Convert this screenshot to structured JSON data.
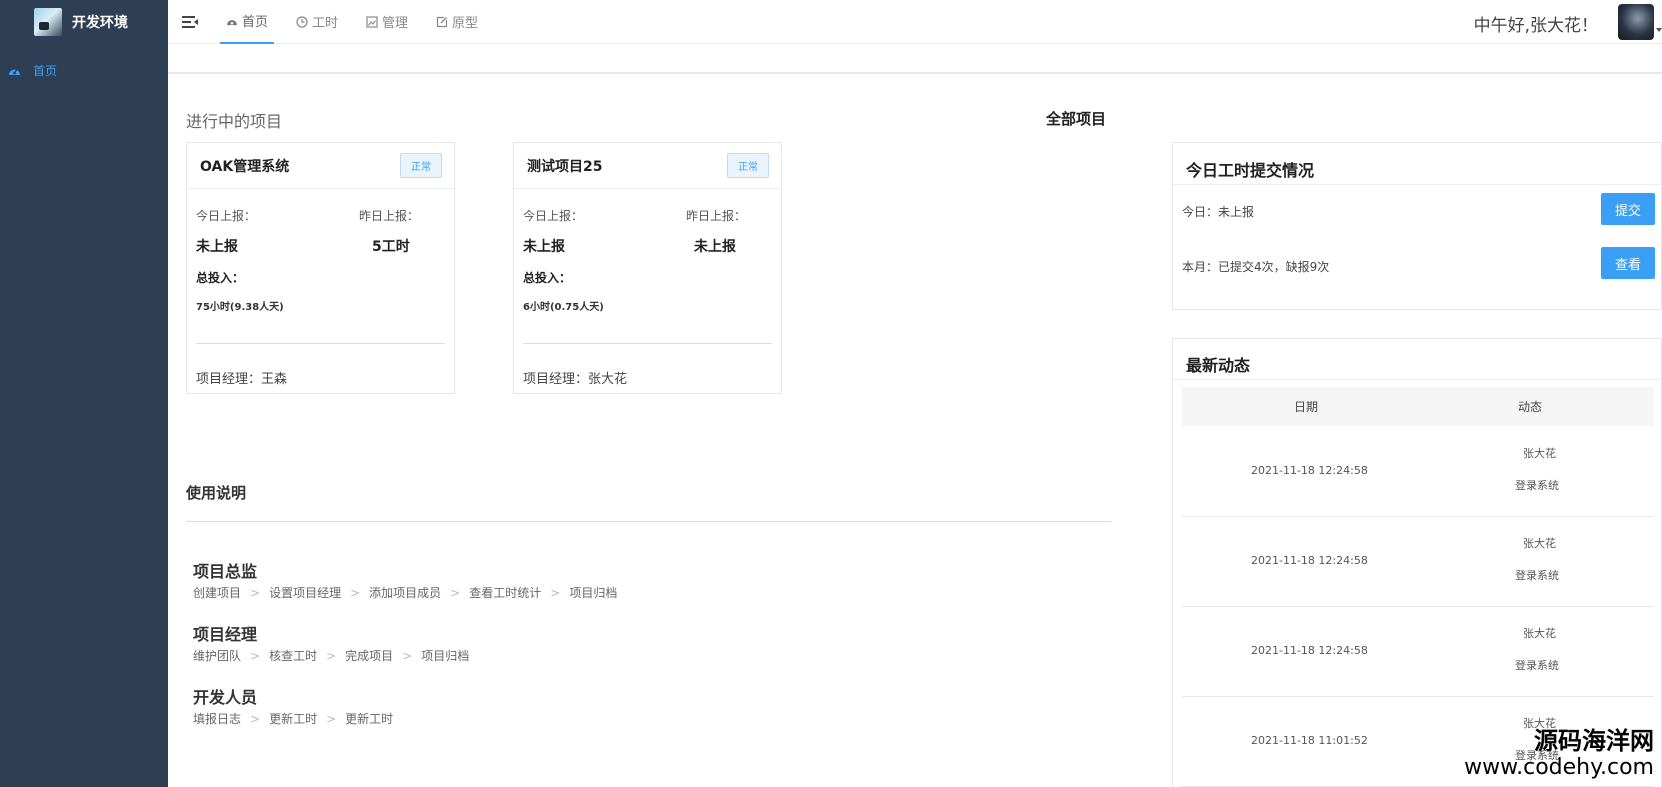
{
  "app": {
    "title": "开发环境"
  },
  "sidebar": {
    "items": [
      {
        "label": "首页",
        "icon": "dashboard-icon",
        "active": true
      }
    ]
  },
  "header": {
    "tabs": [
      {
        "label": "首页",
        "icon": "dashboard-icon",
        "active": true
      },
      {
        "label": "工时",
        "icon": "clock-icon",
        "active": false
      },
      {
        "label": "管理",
        "icon": "image-icon",
        "active": false
      },
      {
        "label": "原型",
        "icon": "edit-icon",
        "active": false
      }
    ],
    "greeting": "中午好,张大花！"
  },
  "projects": {
    "title": "进行中的项目",
    "all_link": "全部项目",
    "cards": [
      {
        "name": "OAK管理系统",
        "status": "正常",
        "today_label": "今日上报：",
        "today_value": "未上报",
        "yesterday_label": "昨日上报：",
        "yesterday_value": "5工时",
        "total_label": "总投入：",
        "total_value": "75小时(9.38人天)",
        "manager": "项目经理：王森"
      },
      {
        "name": "测试项目25",
        "status": "正常",
        "today_label": "今日上报：",
        "today_value": "未上报",
        "yesterday_label": "昨日上报：",
        "yesterday_value": "未上报",
        "total_label": "总投入：",
        "total_value": "6小时(0.75人天)",
        "manager": "项目经理：张大花"
      }
    ]
  },
  "usage": {
    "title": "使用说明",
    "roles": [
      {
        "title": "项目总监",
        "steps": [
          "创建项目",
          "设置项目经理",
          "添加项目成员",
          "查看工时统计",
          "项目归档"
        ]
      },
      {
        "title": "项目经理",
        "steps": [
          "维护团队",
          "核查工时",
          "完成项目",
          "项目归档"
        ]
      },
      {
        "title": "开发人员",
        "steps": [
          "填报日志",
          "更新工时",
          "更新工时"
        ]
      }
    ]
  },
  "today_panel": {
    "title": "今日工时提交情况",
    "today_text": "今日：未上报",
    "submit_label": "提交",
    "month_text": "本月：已提交4次，缺报9次",
    "view_label": "查看"
  },
  "activity": {
    "title": "最新动态",
    "columns": [
      "日期",
      "动态"
    ],
    "rows": [
      {
        "date": "2021-11-18 12:24:58",
        "user": "张大花",
        "action": "登录系统"
      },
      {
        "date": "2021-11-18 12:24:58",
        "user": "张大花",
        "action": "登录系统"
      },
      {
        "date": "2021-11-18 12:24:58",
        "user": "张大花",
        "action": "登录系统"
      },
      {
        "date": "2021-11-18 11:01:52",
        "user": "张大花",
        "action": "登录系统"
      }
    ]
  },
  "watermark": {
    "line1": "源码海洋网",
    "line2": "www.codehy.com"
  },
  "colors": {
    "sidebar": "#2e3e54",
    "accent": "#3a9ff5"
  }
}
